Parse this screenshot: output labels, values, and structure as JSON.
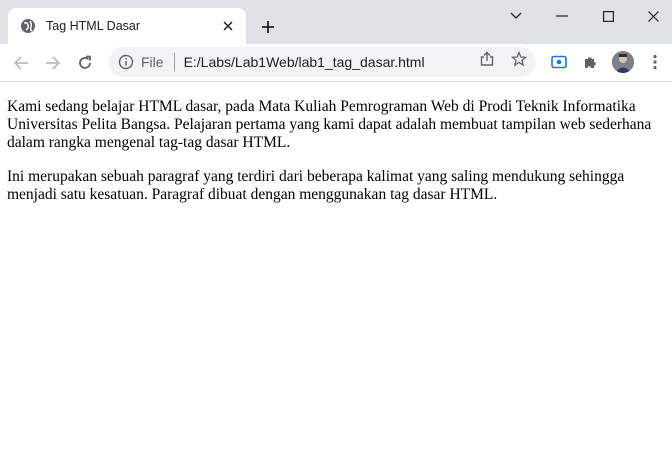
{
  "tab": {
    "title": "Tag HTML Dasar",
    "favicon": "globe-icon"
  },
  "toolbar": {
    "file_label": "File",
    "url": "E:/Labs/Lab1Web/lab1_tag_dasar.html"
  },
  "colors": {
    "titlebar_bg": "#dee1e6",
    "omnibox_bg": "#f1f3f4",
    "accent": "#1a73e8"
  },
  "page": {
    "paragraphs": [
      "Kami sedang belajar HTML dasar, pada Mata Kuliah Pemrograman Web di Prodi Teknik Informatika Universitas Pelita Bangsa. Pelajaran pertama yang kami dapat adalah membuat tampilan web sederhana dalam rangka mengenal tag-tag dasar HTML.",
      "Ini merupakan sebuah paragraf yang terdiri dari beberapa kalimat yang saling mendukung sehingga menjadi satu kesatuan. Paragraf dibuat dengan menggunakan tag dasar HTML."
    ]
  }
}
